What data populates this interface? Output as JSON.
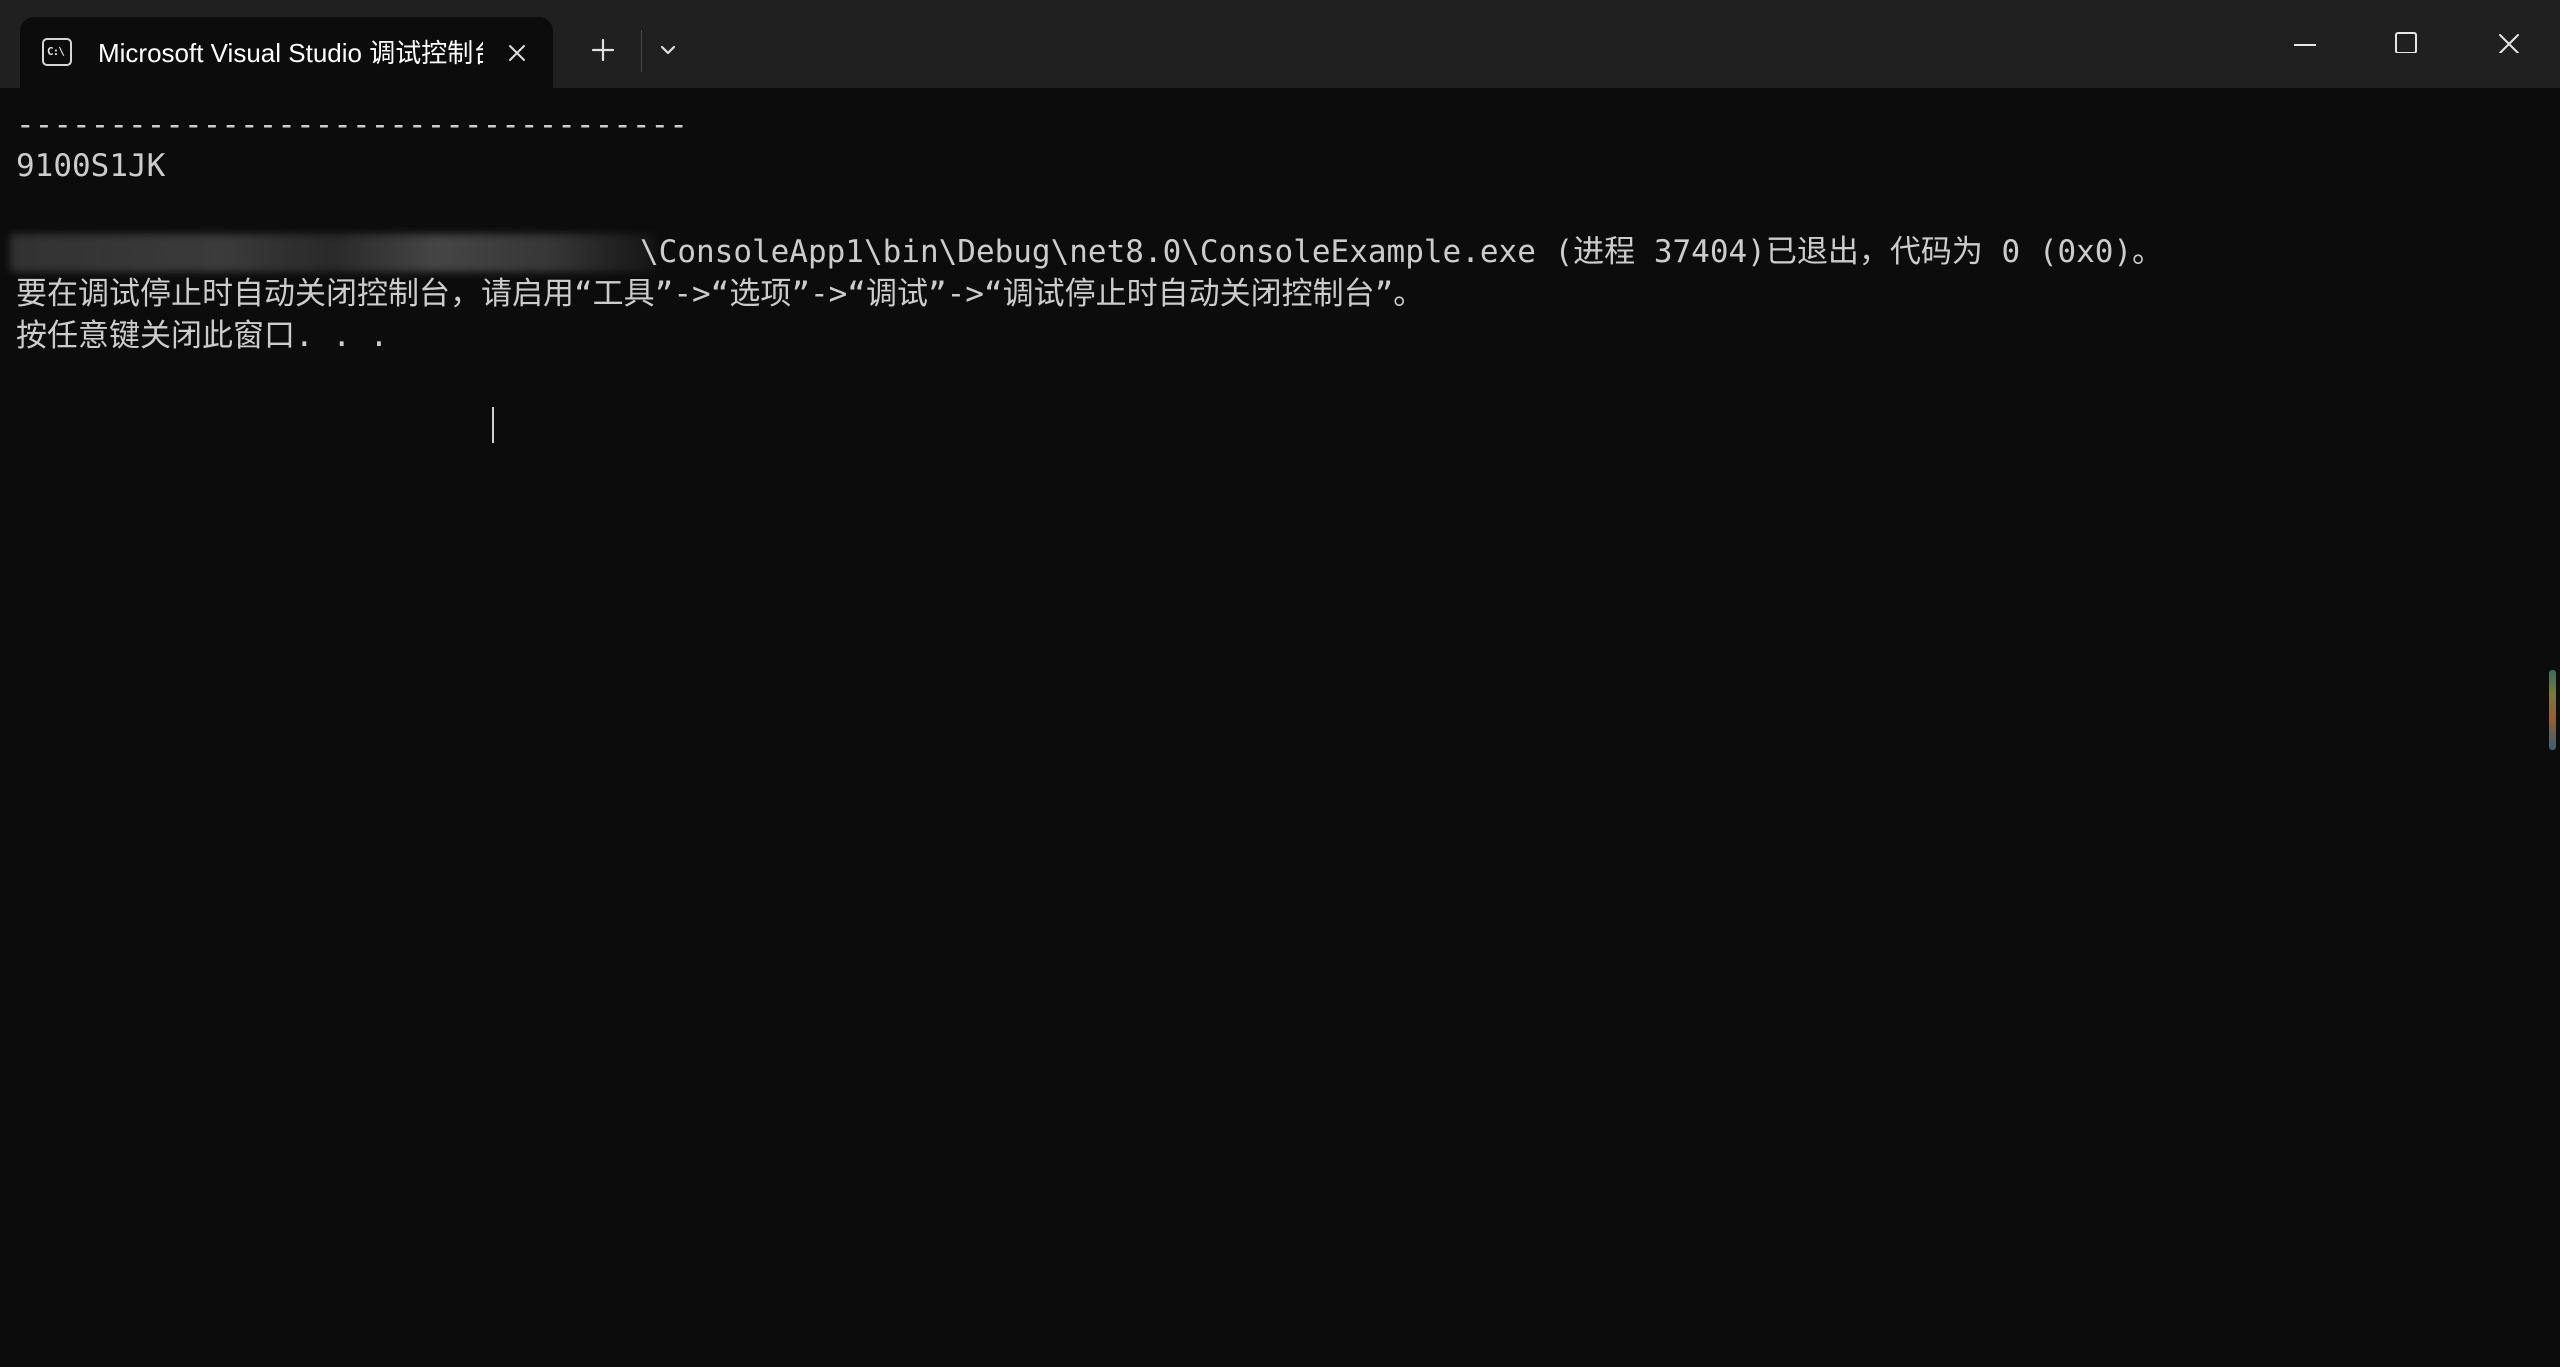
{
  "window": {
    "tab_title": "Microsoft Visual Studio 调试控制台",
    "tab_icon": "console-icon",
    "tab_icon_text": "C:\\",
    "buttons": {
      "close_tab": "close-icon",
      "new_tab": "plus-icon",
      "dropdown": "chevron-down-icon",
      "minimize": "minimize-icon",
      "maximize": "maximize-icon",
      "close": "close-icon"
    }
  },
  "console": {
    "lines": [
      "------------------------------------",
      "9100S1JK",
      "",
      "\\ConsoleApp1\\bin\\Debug\\net8.0\\ConsoleExample.exe (进程 37404)已退出，代码为 0 (0x0)。",
      "要在调试停止时自动关闭控制台，请启用“工具”->“选项”->“调试”->“调试停止时自动关闭控制台”。",
      "按任意键关闭此窗口. . ."
    ]
  },
  "colors": {
    "background": "#0c0c0c",
    "titlebar": "#202020",
    "text": "#cccccc",
    "title_text": "#ffffff"
  }
}
